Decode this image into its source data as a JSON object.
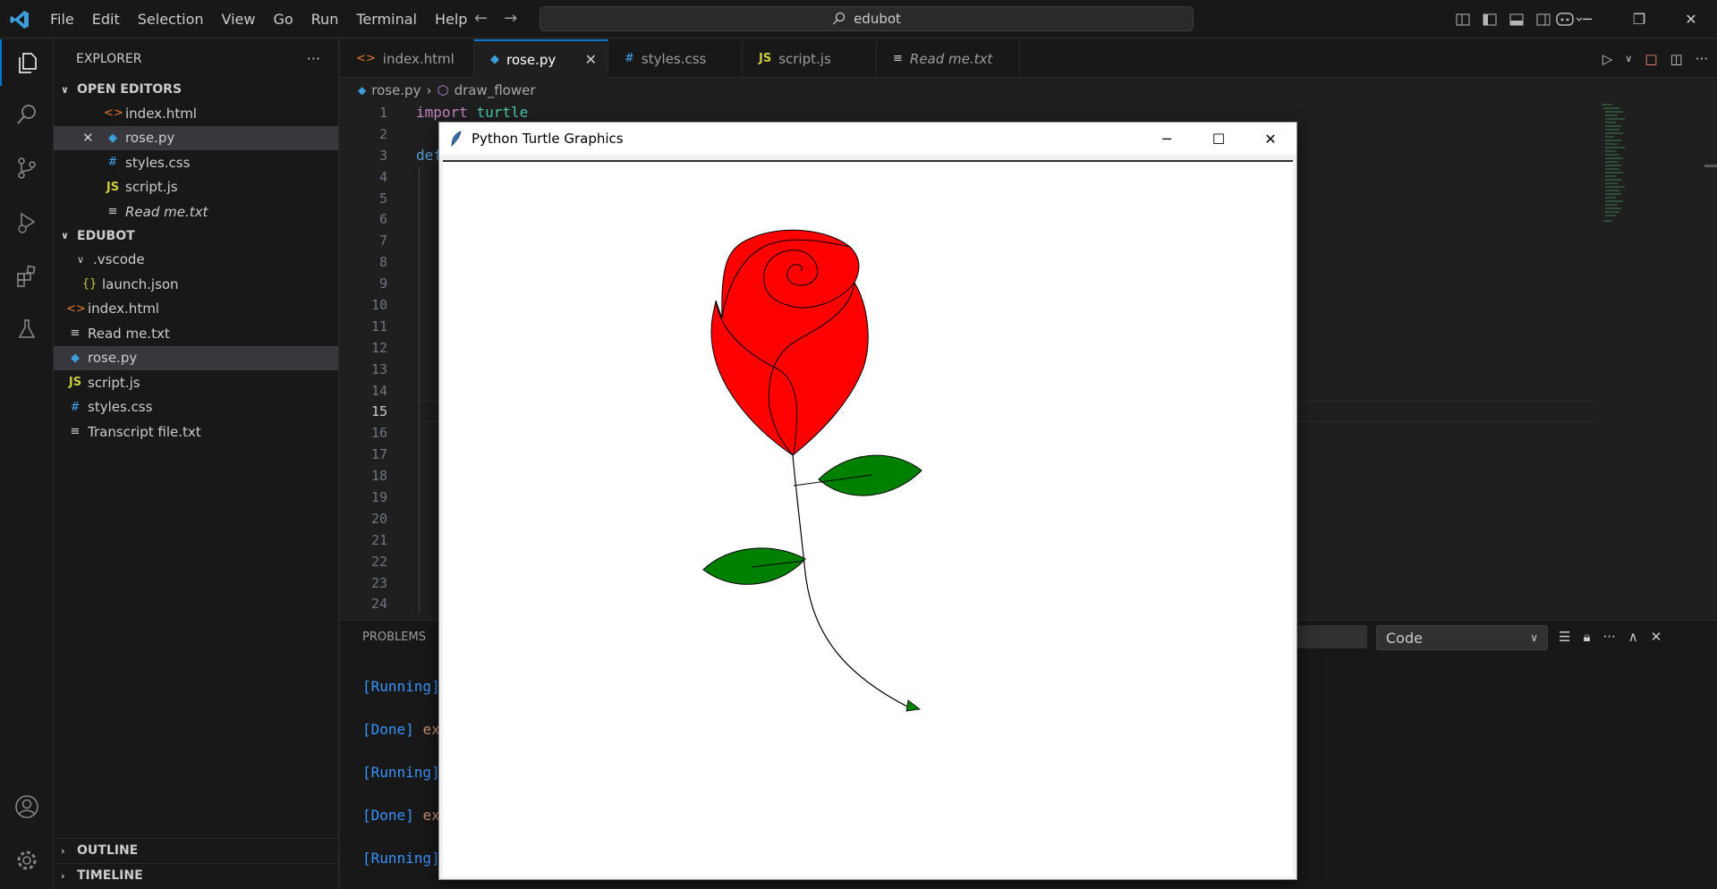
{
  "menu": [
    "File",
    "Edit",
    "Selection",
    "View",
    "Go",
    "Run",
    "Terminal",
    "Help"
  ],
  "search": {
    "text": "edubot"
  },
  "sidebar": {
    "title": "EXPLORER",
    "open_editors_label": "OPEN EDITORS",
    "open_editors": [
      {
        "name": "index.html",
        "icon": "html-icon"
      },
      {
        "name": "rose.py",
        "icon": "python-icon"
      },
      {
        "name": "styles.css",
        "icon": "css-icon"
      },
      {
        "name": "script.js",
        "icon": "js-icon"
      },
      {
        "name": "Read me.txt",
        "icon": "text-icon"
      }
    ],
    "workspace_label": "EDUBOT",
    "files": [
      {
        "name": ".vscode",
        "icon": "folder-chevron-icon"
      },
      {
        "name": "launch.json",
        "icon": "json-icon"
      },
      {
        "name": "index.html",
        "icon": "html-icon"
      },
      {
        "name": "Read me.txt",
        "icon": "text-icon"
      },
      {
        "name": "rose.py",
        "icon": "python-icon"
      },
      {
        "name": "script.js",
        "icon": "js-icon"
      },
      {
        "name": "styles.css",
        "icon": "css-icon"
      },
      {
        "name": "Transcript file.txt",
        "icon": "text-icon"
      }
    ],
    "outline_label": "OUTLINE",
    "timeline_label": "TIMELINE"
  },
  "tabs": [
    {
      "label": "index.html",
      "icon": "html-icon"
    },
    {
      "label": "rose.py",
      "icon": "python-icon",
      "active": true
    },
    {
      "label": "styles.css",
      "icon": "css-icon"
    },
    {
      "label": "script.js",
      "icon": "js-icon"
    },
    {
      "label": "Read me.txt",
      "icon": "text-icon"
    }
  ],
  "breadcrumb": {
    "file": "rose.py",
    "symbol": "draw_flower"
  },
  "editor": {
    "line_numbers": [
      "1",
      "2",
      "3",
      "4",
      "5",
      "6",
      "7",
      "8",
      "9",
      "10",
      "11",
      "12",
      "13",
      "14",
      "15",
      "16",
      "17",
      "18",
      "19",
      "20",
      "21",
      "22",
      "23",
      "24"
    ],
    "current_line": "15",
    "line1_keyword": "import",
    "line1_module": "turtle",
    "line3_fragment": "def"
  },
  "panel": {
    "tab_label": "PROBLEMS",
    "select_value": "Code",
    "output": [
      {
        "tag": "[Running]",
        "rest": ""
      },
      {
        "tag": "[Done]",
        "rest": "ex"
      },
      {
        "tag": "[Running]",
        "rest": ""
      },
      {
        "tag": "[Done]",
        "rest": "ex"
      },
      {
        "tag": "[Running]",
        "rest": ""
      }
    ]
  },
  "turtle_window": {
    "title": "Python Turtle Graphics"
  },
  "colors": {
    "accent": "#0078d4",
    "rose": "#ff0000",
    "leaf": "#008000"
  }
}
